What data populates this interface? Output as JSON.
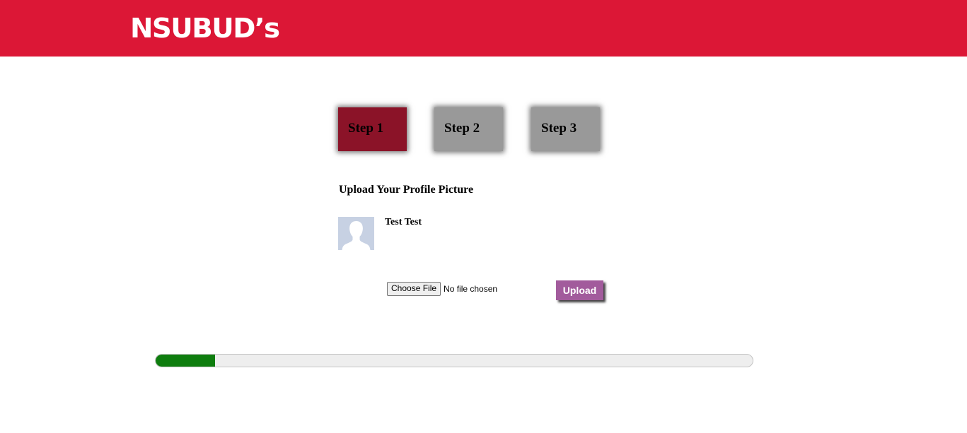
{
  "header": {
    "logo_text": "NSUBUD’s",
    "background_color": "#dc1736"
  },
  "steps": [
    {
      "label": "Step 1",
      "active": true
    },
    {
      "label": "Step 2",
      "active": false
    },
    {
      "label": "Step 3",
      "active": false
    }
  ],
  "colors": {
    "active_step": "#8b1328",
    "inactive_step": "#999999",
    "upload_button": "#a25b9c",
    "progress_fill": "#0e7d0e"
  },
  "upload": {
    "title": "Upload Your Profile Picture",
    "user_name": "Test Test",
    "choose_file_label": "Choose File",
    "file_status": "No file chosen",
    "upload_button_label": "Upload"
  },
  "progress": {
    "fraction": 0.1
  }
}
